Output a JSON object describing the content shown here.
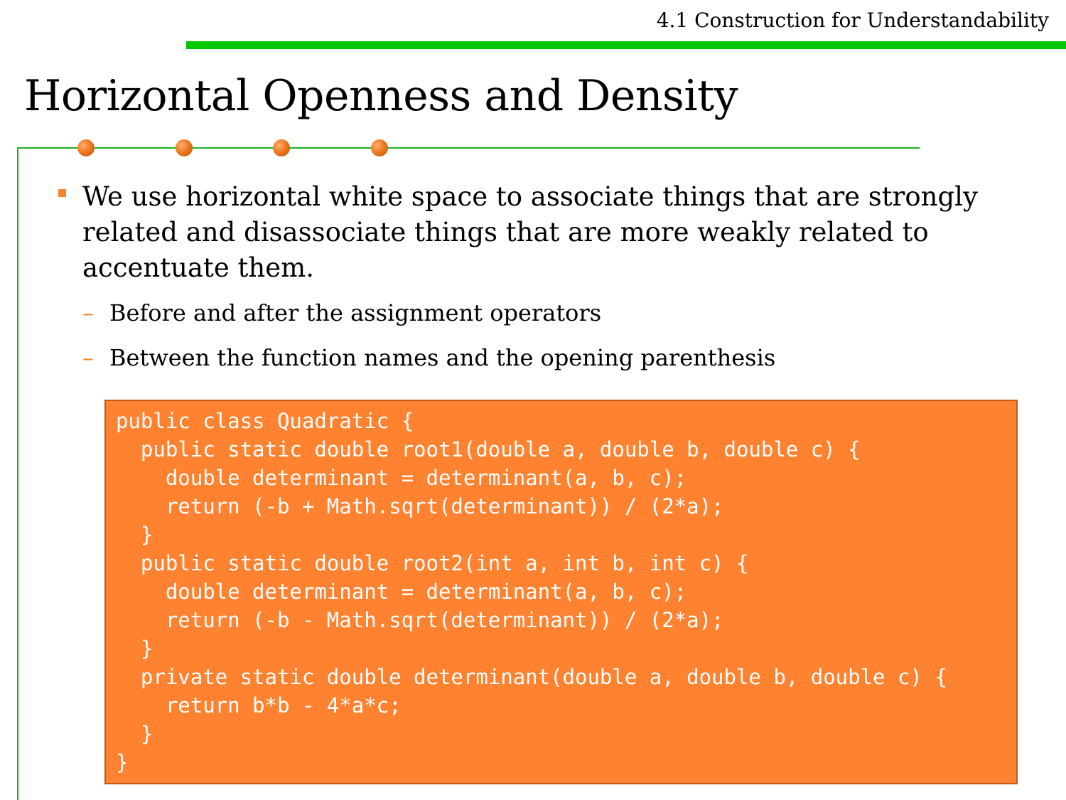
{
  "header": {
    "section_title": "4.1 Construction for Understandability"
  },
  "slide": {
    "title": "Horizontal Openness and Density"
  },
  "content": {
    "bullet": "We use horizontal white space to associate things that are strongly related and disassociate things that are more weakly related to accentuate them.",
    "sub_items": [
      "Before and after the assignment operators",
      "Between the function names and the opening parenthesis"
    ],
    "code_lines": [
      "public class Quadratic {",
      "  public static double root1(double a, double b, double c) {",
      "    double determinant = determinant(a, b, c);",
      "    return (-b + Math.sqrt(determinant)) / (2*a);",
      "  }",
      "  public static double root2(int a, int b, int c) {",
      "    double determinant = determinant(a, b, c);",
      "    return (-b - Math.sqrt(determinant)) / (2*a);",
      "  }",
      "  private static double determinant(double a, double b, double c) {",
      "    return b*b - 4*a*c;",
      "  }",
      "}"
    ]
  },
  "colors": {
    "green_accent": "#00c800",
    "orange_accent": "#f5842a",
    "code_background": "#ff8230"
  },
  "icons": [
    "orange-sphere-icon",
    "square-bullet-icon",
    "dash-bullet-icon"
  ]
}
